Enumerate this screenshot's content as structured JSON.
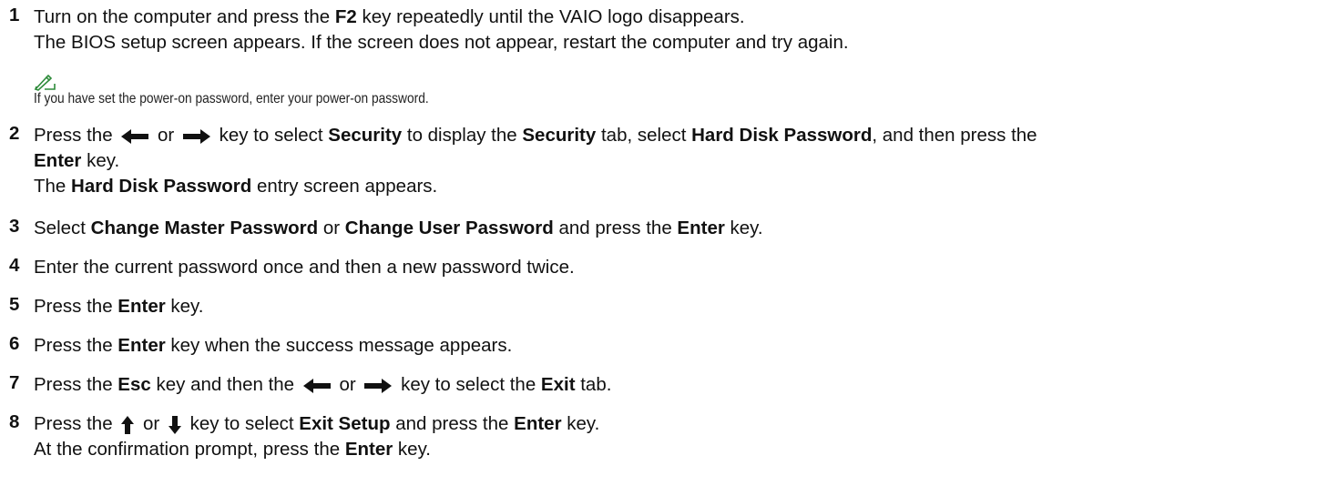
{
  "steps": [
    {
      "num": "1",
      "lines": [
        [
          "Turn on the computer and press the ",
          {
            "b": "F2"
          },
          " key repeatedly until the VAIO logo disappears."
        ],
        [
          "The BIOS setup screen appears. If the screen does not appear, restart the computer and try again."
        ]
      ]
    },
    {
      "num": "2",
      "lines": [
        [
          "Press the ",
          {
            "icon": "left"
          },
          " or ",
          {
            "icon": "right"
          },
          " key to select ",
          {
            "b": "Security"
          },
          " to display the ",
          {
            "b": "Security"
          },
          " tab, select ",
          {
            "b": "Hard Disk Password"
          },
          ", and then press the"
        ],
        [
          {
            "b": "Enter"
          },
          " key."
        ],
        [
          "The ",
          {
            "b": "Hard Disk Password"
          },
          " entry screen appears."
        ]
      ]
    },
    {
      "num": "3",
      "lines": [
        [
          "Select ",
          {
            "b": "Change Master Password"
          },
          " or ",
          {
            "b": "Change User Password"
          },
          " and press the ",
          {
            "b": "Enter"
          },
          " key."
        ]
      ]
    },
    {
      "num": "4",
      "lines": [
        [
          "Enter the current password once and then a new password twice."
        ]
      ]
    },
    {
      "num": "5",
      "lines": [
        [
          "Press the ",
          {
            "b": "Enter"
          },
          " key."
        ]
      ]
    },
    {
      "num": "6",
      "lines": [
        [
          "Press the ",
          {
            "b": "Enter"
          },
          " key when the success message appears."
        ]
      ]
    },
    {
      "num": "7",
      "lines": [
        [
          "Press the ",
          {
            "b": "Esc"
          },
          " key and then the ",
          {
            "icon": "left"
          },
          " or ",
          {
            "icon": "right"
          },
          " key to select the ",
          {
            "b": "Exit"
          },
          " tab."
        ]
      ]
    },
    {
      "num": "8",
      "lines": [
        [
          "Press the ",
          {
            "icon": "up"
          },
          " or ",
          {
            "icon": "down"
          },
          " key to select ",
          {
            "b": "Exit Setup"
          },
          " and press the ",
          {
            "b": "Enter"
          },
          " key."
        ],
        [
          "At the confirmation prompt, press the ",
          {
            "b": "Enter"
          },
          " key."
        ]
      ]
    }
  ],
  "note": {
    "icon": "note-pen-icon",
    "text": "If you have set the power-on password, enter your power-on password."
  },
  "colors": {
    "note_icon": "#2e8b3a",
    "text": "#111111"
  }
}
